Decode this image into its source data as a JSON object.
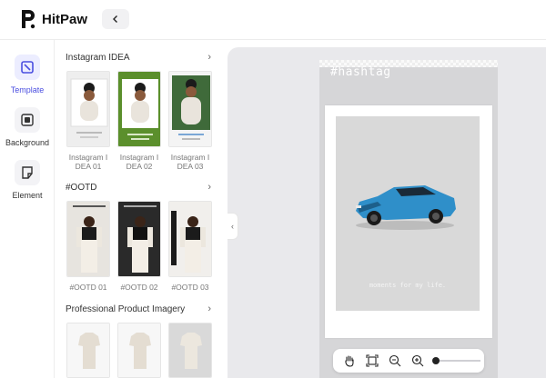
{
  "app": {
    "name": "HitPaw"
  },
  "rail": {
    "items": [
      {
        "label": "Template",
        "icon": "template-icon",
        "active": true
      },
      {
        "label": "Background",
        "icon": "background-icon",
        "active": false
      },
      {
        "label": "Element",
        "icon": "element-icon",
        "active": false
      }
    ]
  },
  "sections": [
    {
      "title": "Instagram IDEA",
      "items": [
        {
          "caption": "Instagram I\nDEA 01"
        },
        {
          "caption": "Instagram I\nDEA 02"
        },
        {
          "caption": "Instagram I\nDEA 03"
        }
      ]
    },
    {
      "title": "#OOTD",
      "items": [
        {
          "caption": "#OOTD 01"
        },
        {
          "caption": "#OOTD 02"
        },
        {
          "caption": "#OOTD 03"
        }
      ]
    },
    {
      "title": "Professional Product Imagery",
      "items": [
        {},
        {},
        {}
      ]
    }
  ],
  "canvas": {
    "hashtag": "#hashtag",
    "caption": "moments for my life.",
    "car_color": "#2f8fc9"
  },
  "zoombar": {
    "tools": [
      "hand-icon",
      "fit-screen-icon",
      "zoom-out-icon",
      "zoom-in-icon"
    ],
    "zoom_level": 0.05
  },
  "colors": {
    "accent": "#4a4ee0",
    "green_thumb": "#5b8f2c"
  }
}
